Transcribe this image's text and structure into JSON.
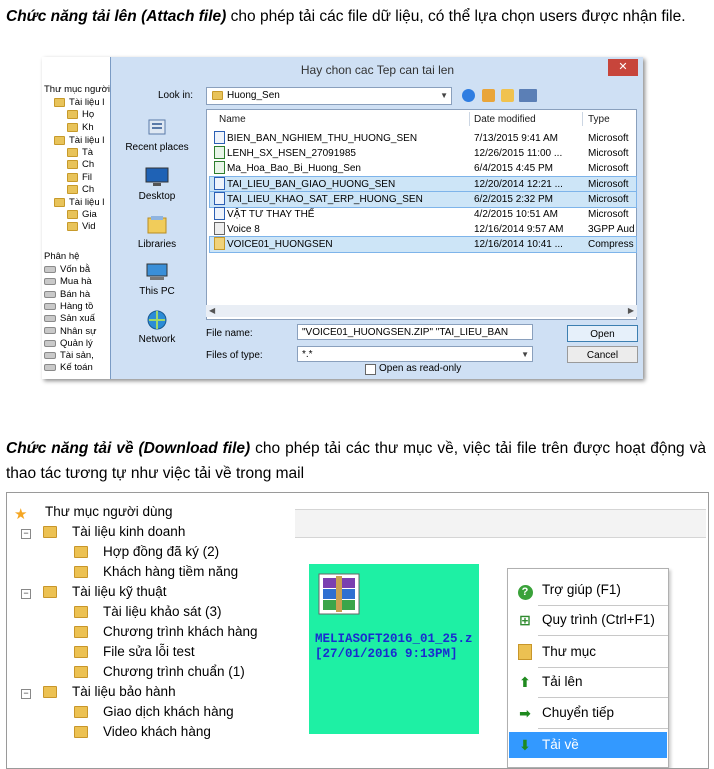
{
  "intro": {
    "attach_title": "Chức năng tải lên (Attach file)",
    "attach_text": " cho phép tải các file dữ liệu, có thể lựa chọn users được nhận file.",
    "download_title": "Chức năng tải về (Download file)",
    "download_text": " cho phép tải các thư mục về, việc tải file trên được hoạt động và thao tác tương tự như việc tải về trong mail"
  },
  "bg_tree": {
    "root": "Thư mục người",
    "items": [
      "Tài liệu l",
      "Họ",
      "Kh",
      "Tài liệu l",
      "Tà",
      "Ch",
      "Fil",
      "Ch",
      "Tài liệu l",
      "Gia",
      "Vid"
    ],
    "section": "Phân hệ",
    "modules": [
      "Vốn bằ",
      "Mua hà",
      "Bán hà",
      "Hàng tồ",
      "Sản xuấ",
      "Nhân sự",
      "Quản lý",
      "Tài sản,",
      "Kế toán"
    ]
  },
  "dialog": {
    "title": "Hay chon cac Tep can tai len",
    "close_glyph": "✕",
    "look_in_label": "Look in:",
    "look_in_value": "Huong_Sen",
    "places": [
      "Recent places",
      "Desktop",
      "Libraries",
      "This PC",
      "Network"
    ],
    "columns": [
      "Name",
      "Date modified",
      "Type"
    ],
    "files": [
      {
        "name": "BIEN_BAN_NGHIEM_THU_HUONG_SEN",
        "date": "7/13/2015 9:41 AM",
        "type": "Microsoft",
        "icon": "word-icon"
      },
      {
        "name": "LENH_SX_HSEN_27091985",
        "date": "12/26/2015 11:00 ...",
        "type": "Microsoft",
        "icon": "excel-icon"
      },
      {
        "name": "Ma_Hoa_Bao_Bi_Huong_Sen",
        "date": "6/4/2015 4:45 PM",
        "type": "Microsoft",
        "icon": "excel-icon"
      },
      {
        "name": "TAI_LIEU_BAN_GIAO_HUONG_SEN",
        "date": "12/20/2014 12:21 ...",
        "type": "Microsoft",
        "icon": "word-icon"
      },
      {
        "name": "TAI_LIEU_KHAO_SAT_ERP_HUONG_SEN",
        "date": "6/2/2015 2:32 PM",
        "type": "Microsoft",
        "icon": "word-icon"
      },
      {
        "name": "VẬT TƯ THAY THẾ",
        "date": "4/2/2015 10:51 AM",
        "type": "Microsoft",
        "icon": "word-icon"
      },
      {
        "name": "Voice 8",
        "date": "12/16/2014 9:57 AM",
        "type": "3GPP Aud",
        "icon": "audio-icon"
      },
      {
        "name": "VOICE01_HUONGSEN",
        "date": "12/16/2014 10:41 ...",
        "type": "Compress",
        "icon": "zip-icon"
      }
    ],
    "selected_rows": [
      3,
      4,
      7
    ],
    "file_name_label": "File name:",
    "file_name_value": "\"VOICE01_HUONGSEN.ZIP\" \"TAI_LIEU_BAN",
    "files_of_type_label": "Files of type:",
    "files_of_type_value": "*.*",
    "open_label": "Open",
    "cancel_label": "Cancel",
    "read_only_label": "Open as read-only"
  },
  "tree": {
    "root": "Thư mục người dùng",
    "groups": [
      {
        "label": "Tài liệu kinh doanh",
        "children": [
          "Hợp đồng đã ký (2)",
          "Khách hàng tiềm năng"
        ]
      },
      {
        "label": "Tài liệu kỹ thuật",
        "children": [
          "Tài liệu khảo sát (3)",
          "Chương trình khách hàng",
          "File sửa lỗi test",
          "Chương trình chuẩn (1)"
        ]
      },
      {
        "label": "Tài liệu bảo hành",
        "children": [
          "Giao dịch khách hàng",
          "Video khách hàng"
        ]
      }
    ]
  },
  "tile": {
    "name": "MELIASOFT2016_01_25.z\n[27/01/2016 9:13PM]",
    "color": "#1ef0a4"
  },
  "context_menu": {
    "items": [
      {
        "label": "Trợ giúp (F1)",
        "icon": "help-icon"
      },
      {
        "label": "Quy trình (Ctrl+F1)",
        "icon": "workflow-icon"
      },
      {
        "label": "Thư mục",
        "icon": "folder-icon"
      },
      {
        "label": "Tải lên",
        "icon": "upload-arrow-icon"
      },
      {
        "label": "Chuyển tiếp",
        "icon": "forward-arrow-icon"
      },
      {
        "label": "Tải về",
        "icon": "download-arrow-icon"
      }
    ],
    "active_index": 5,
    "highlight_color": "#3399ff"
  }
}
